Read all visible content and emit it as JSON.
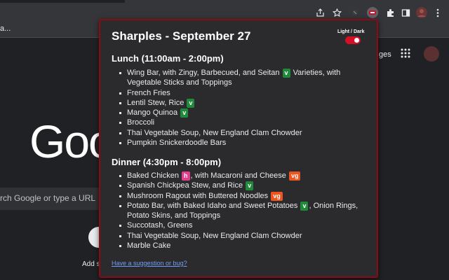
{
  "browser": {
    "bookmark_text": "a..."
  },
  "google": {
    "logo_text": "Goo",
    "search_placeholder": "rch Google or type a URL",
    "shortcut_label": "Add s",
    "images_link": "ges"
  },
  "popup": {
    "title": "Sharples - September 27",
    "toggle_label": "Light / Dark",
    "toggle_on": true,
    "sections": [
      {
        "title": "Lunch (11:00am - 2:00pm)",
        "items": [
          {
            "parts": [
              {
                "text": "Wing Bar, with Zingy, Barbecued, and Seitan "
              },
              {
                "badge": "v"
              },
              {
                "text": " Varieties, with Vegetable Sticks and Toppings"
              }
            ]
          },
          {
            "parts": [
              {
                "text": "French Fries"
              }
            ]
          },
          {
            "parts": [
              {
                "text": "Lentil Stew, Rice "
              },
              {
                "badge": "v"
              }
            ]
          },
          {
            "parts": [
              {
                "text": "Mango Quinoa "
              },
              {
                "badge": "v"
              }
            ]
          },
          {
            "parts": [
              {
                "text": "Broccoli"
              }
            ]
          },
          {
            "parts": [
              {
                "text": "Thai Vegetable Soup, New England Clam Chowder"
              }
            ]
          },
          {
            "parts": [
              {
                "text": "Pumpkin Snickerdoodle Bars"
              }
            ]
          }
        ]
      },
      {
        "title": "Dinner (4:30pm - 8:00pm)",
        "items": [
          {
            "parts": [
              {
                "text": "Baked Chicken "
              },
              {
                "badge": "h"
              },
              {
                "text": ", with Macaroni and Cheese "
              },
              {
                "badge": "vg"
              }
            ]
          },
          {
            "parts": [
              {
                "text": "Spanish Chickpea Stew, and Rice "
              },
              {
                "badge": "v"
              }
            ]
          },
          {
            "parts": [
              {
                "text": "Mushroom Ragout with Buttered Noodles "
              },
              {
                "badge": "vg"
              }
            ]
          },
          {
            "parts": [
              {
                "text": "Potato Bar, with Baked Idaho and Sweet Potatoes "
              },
              {
                "badge": "v"
              },
              {
                "text": ", Onion Rings, Potato Skins, and Toppings"
              }
            ]
          },
          {
            "parts": [
              {
                "text": "Succotash, Greens"
              }
            ]
          },
          {
            "parts": [
              {
                "text": "Thai Vegetable Soup, New England Clam Chowder"
              }
            ]
          },
          {
            "parts": [
              {
                "text": "Marble Cake"
              }
            ]
          }
        ]
      }
    ],
    "suggestion_link": "Have a suggestion or bug?"
  },
  "colors": {
    "popup_border": "#8b0a14",
    "toggle_on": "#d50f25",
    "badge_v": "#1f8a3b",
    "badge_vg": "#f0541e",
    "badge_h": "#e23e8f",
    "link": "#6f9ef8"
  },
  "icons": {
    "toolbar": [
      "share-icon",
      "star-icon",
      "extension-icon",
      "sharples-extension-icon",
      "puzzle-icon",
      "sidebar-icon",
      "profile-avatar",
      "kebab-menu-icon"
    ]
  }
}
